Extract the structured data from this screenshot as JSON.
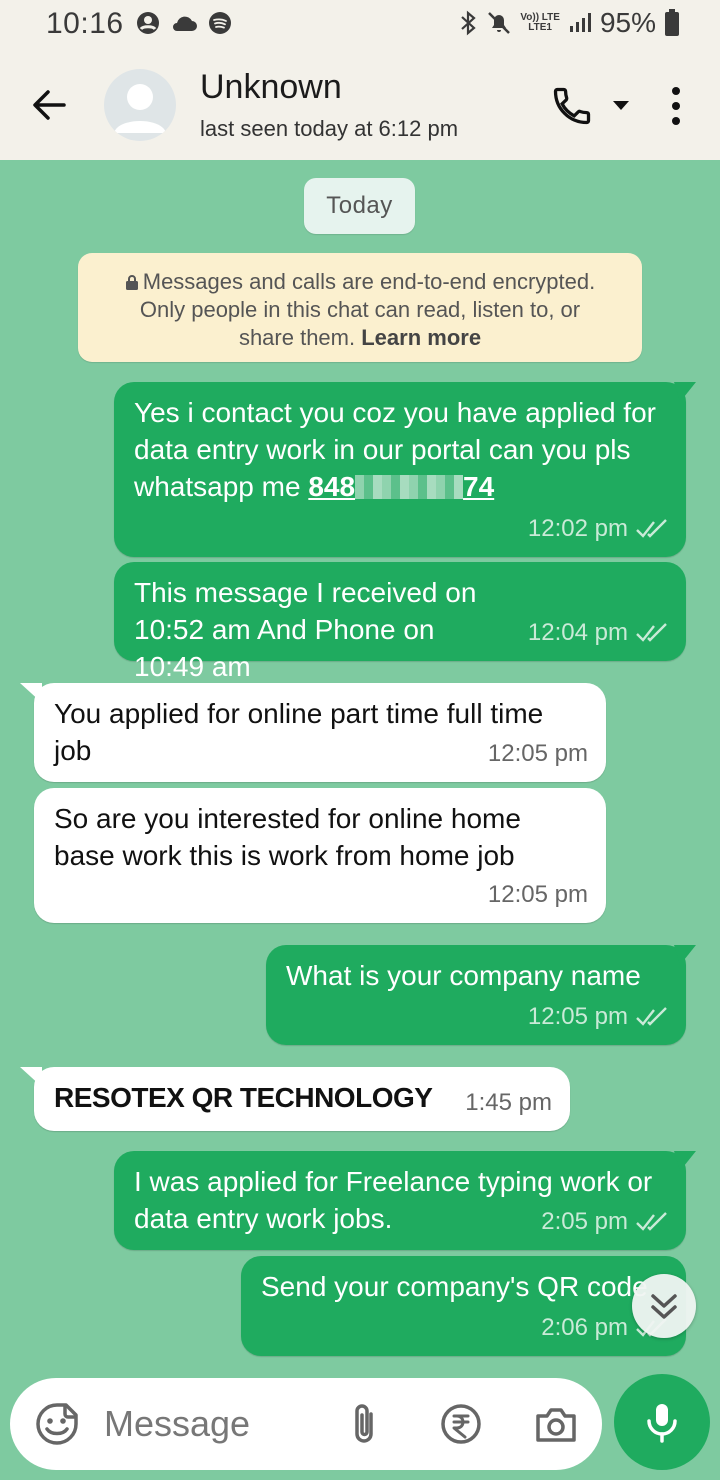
{
  "status_bar": {
    "time": "10:16",
    "battery": "95%",
    "net_top": "Vo)) LTE",
    "net_bottom": "LTE1"
  },
  "header": {
    "contact_name": "Unknown",
    "last_seen": "last seen today at 6:12 pm"
  },
  "date_chip": "Today",
  "encryption": {
    "line1": "Messages and calls are end-to-end encrypted.",
    "line2": "Only people in this chat can read, listen to, or",
    "line3": "share them.",
    "learn_more": "Learn more"
  },
  "messages": [
    {
      "direction": "out",
      "text_prefix": "Yes i contact you coz you have applied for data entry work in our portal can you pls whatsapp me ",
      "phone_start": "848",
      "phone_end": "74",
      "time": "12:02 pm"
    },
    {
      "direction": "out",
      "text": "This message I received on 10:52 am And Phone on 10:49 am",
      "time": "12:04 pm"
    },
    {
      "direction": "in",
      "text": "You applied for online part time full time job",
      "time": "12:05 pm"
    },
    {
      "direction": "in",
      "text": "So are you interested for online home base work this is work from home job",
      "time": "12:05 pm"
    },
    {
      "direction": "out",
      "text": "What is your company name",
      "time": "12:05 pm"
    },
    {
      "direction": "in",
      "text": "RESOTEX QR TECHNOLOGY",
      "time": "1:45 pm"
    },
    {
      "direction": "out",
      "text": "I was applied for Freelance typing work or data entry work jobs.",
      "time": "2:05 pm"
    },
    {
      "direction": "out",
      "text": "Send your company's QR code",
      "time": "2:06 pm"
    }
  ],
  "input": {
    "placeholder": "Message"
  },
  "colors": {
    "chat_bg": "#7ecaa0",
    "outgoing": "#1fab5f",
    "incoming": "#ffffff",
    "header_bg": "#f3f1ea"
  }
}
